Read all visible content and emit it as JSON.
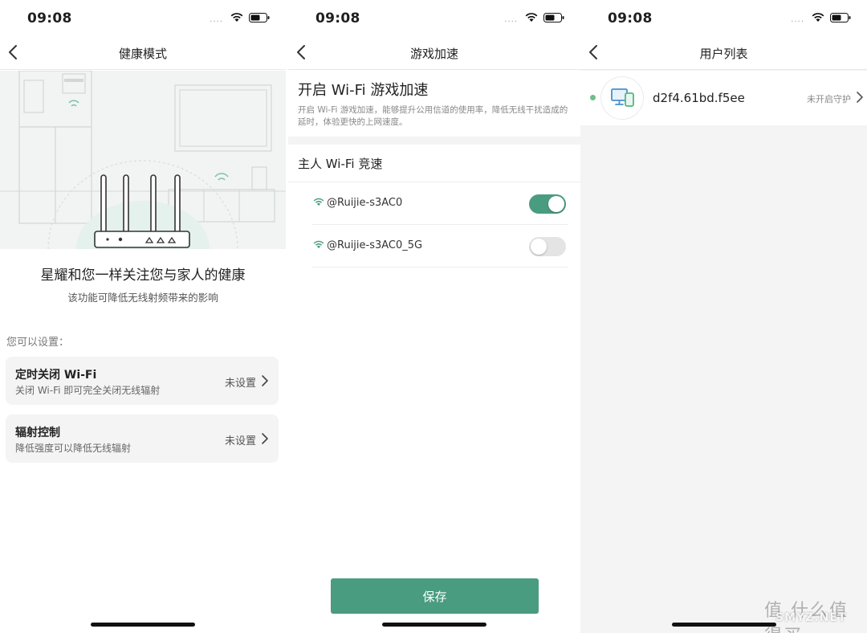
{
  "colors": {
    "accent": "#4a9c80",
    "dot_online": "#6dbf8c",
    "card_bg": "#f4f4f4"
  },
  "status": {
    "time": "09:08",
    "signal_dots": "....",
    "icons": [
      "wifi-icon",
      "battery-icon"
    ]
  },
  "screen1": {
    "nav_title": "健康模式",
    "headline": "星耀和您一样关注您与家人的健康",
    "subheadline": "该功能可降低无线射频带来的影响",
    "section_label": "您可以设置：",
    "cards": [
      {
        "title": "定时关闭 Wi-Fi",
        "subtitle": "关闭 Wi-Fi 即可完全关闭无线辐射",
        "value": "未设置"
      },
      {
        "title": "辐射控制",
        "subtitle": "降低强度可以降低无线辐射",
        "value": "未设置"
      }
    ]
  },
  "screen2": {
    "nav_title": "游戏加速",
    "title": "开启 Wi-Fi 游戏加速",
    "description": "开启 Wi-Fi 游戏加速，能够提升公用信道的使用率，降低无线干扰造成的延时，体验更快的上网速度。",
    "section_title": "主人 Wi-Fi 竞速",
    "networks": [
      {
        "name": "@Ruijie-s3AC0",
        "enabled": true
      },
      {
        "name": "@Ruijie-s3AC0_5G",
        "enabled": false
      }
    ],
    "save_label": "保存"
  },
  "screen3": {
    "nav_title": "用户列表",
    "users": [
      {
        "name": "d2f4.61bd.f5ee",
        "status": "未开启守护"
      }
    ]
  },
  "watermark": {
    "zh": "值 什么值得买",
    "en": "SMYZ.NET"
  }
}
